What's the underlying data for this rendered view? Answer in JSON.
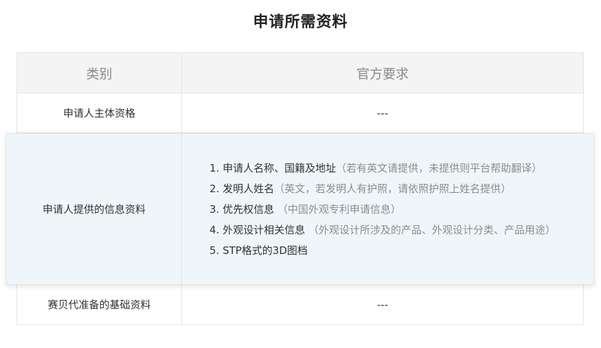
{
  "page": {
    "title": "申请所需资料"
  },
  "table": {
    "headers": {
      "category": "类别",
      "requirement": "官方要求"
    },
    "rows": [
      {
        "category": "申请人主体资格",
        "requirement": "---"
      },
      {
        "category": "申请人提供的信息资料",
        "items": [
          {
            "main": "1. 申请人名称、国籍及地址",
            "note": "（若有英文请提供，未提供则平台帮助翻译）"
          },
          {
            "main": "2. 发明人姓名",
            "note": "（英文，若发明人有护照，请依照护照上姓名提供）"
          },
          {
            "main": "3. 优先权信息 ",
            "note": "（中国外观专利申请信息）"
          },
          {
            "main": "4. 外观设计相关信息 ",
            "note": "（外观设计所涉及的产品、外观设计分类、产品用途）"
          },
          {
            "main": "5. STP格式的3D图档",
            "note": ""
          }
        ]
      },
      {
        "category": "赛贝代准备的基础资料",
        "requirement": "---"
      }
    ]
  },
  "colors": {
    "header_bg": "#f4f4f4",
    "highlight_bg": "#eff6f9",
    "border": "#e4e4e4",
    "note_text": "#8c8c8c"
  }
}
